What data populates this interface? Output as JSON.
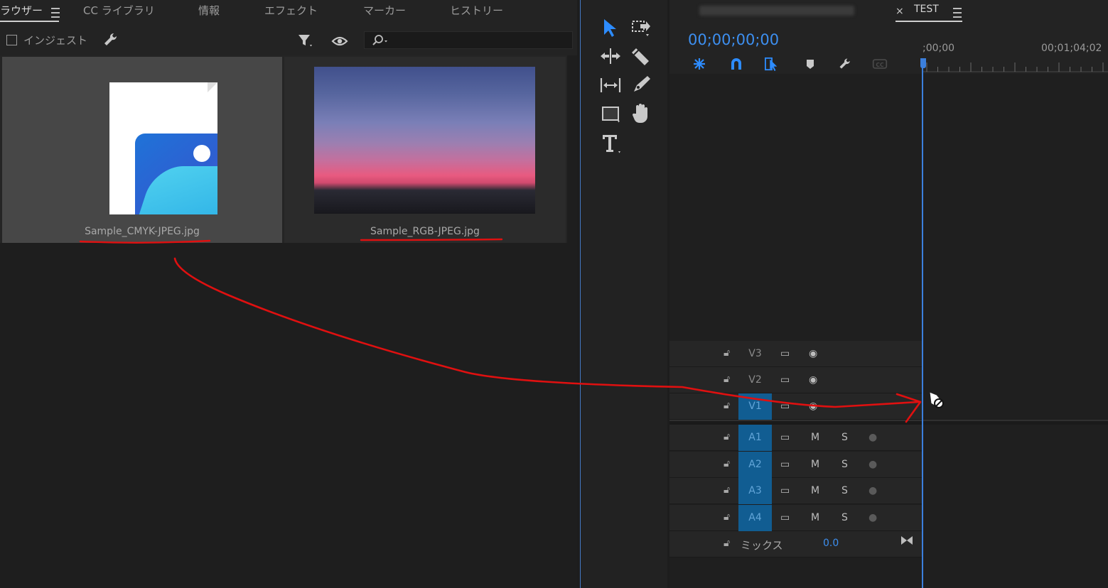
{
  "colors": {
    "accent": "#3d8ff0",
    "track_on": "#115d92",
    "annotation": "#e01010"
  },
  "tabs": [
    {
      "label": "ラウザー"
    },
    {
      "label": "CC ライブラリ"
    },
    {
      "label": "情報"
    },
    {
      "label": "エフェクト"
    },
    {
      "label": "マーカー"
    },
    {
      "label": "ヒストリー"
    }
  ],
  "browser_toolbar": {
    "ingest_label": "インジェスト",
    "icons": [
      "wrench-icon",
      "filter-icon",
      "eye-icon",
      "search-icon"
    ],
    "search_value": ""
  },
  "media": [
    {
      "name": "Sample_CMYK-JPEG.jpg",
      "thumb": "image-file-icon",
      "selected": true
    },
    {
      "name": "Sample_RGB-JPEG.jpg",
      "thumb": "sunset-photo",
      "selected": false
    }
  ],
  "tools": [
    "selection-tool",
    "track-select-forward-tool",
    "ripple-edit-tool",
    "razor-tool",
    "slip-tool",
    "pen-tool",
    "rectangle-tool",
    "hand-tool",
    "type-tool"
  ],
  "timeline": {
    "blurred_sequence_tab": "",
    "sequence_tab": "TEST",
    "timecode": "00;00;00;00",
    "ruler_start": ";00;00",
    "ruler_end": "00;01;04;02",
    "video_tracks": [
      {
        "name": "V3",
        "on": false
      },
      {
        "name": "V2",
        "on": false
      },
      {
        "name": "V1",
        "on": true
      }
    ],
    "audio_tracks": [
      {
        "name": "A1",
        "mute": "M",
        "solo": "S"
      },
      {
        "name": "A2",
        "mute": "M",
        "solo": "S"
      },
      {
        "name": "A3",
        "mute": "M",
        "solo": "S"
      },
      {
        "name": "A4",
        "mute": "M",
        "solo": "S"
      }
    ],
    "mix": {
      "label": "ミックス",
      "value": "0.0"
    }
  }
}
